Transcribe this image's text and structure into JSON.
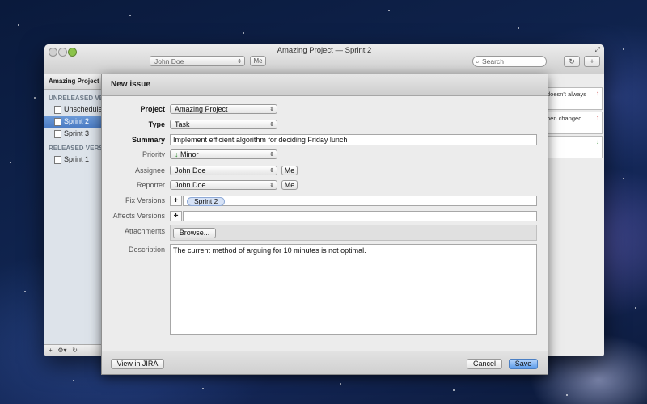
{
  "window": {
    "title": "Amazing Project — Sprint 2",
    "user_select": "John Doe",
    "me_button": "Me",
    "search_placeholder": "Search",
    "refresh_icon": "↻",
    "add_icon": "+"
  },
  "sidebar": {
    "header": "Amazing Project",
    "unreleased_label": "UNRELEASED VERSIONS",
    "unreleased_items": [
      "Unscheduled",
      "Sprint 2",
      "Sprint 3"
    ],
    "released_label": "RELEASED VERSIONS",
    "released_items": [
      "Sprint 1"
    ],
    "footer_add": "+",
    "footer_gear": "⚙▾",
    "footer_refresh": "↻",
    "selected": "Sprint 2"
  },
  "right_cards": [
    {
      "text": "doesn't always",
      "arrow": "↑",
      "arrow_color": "#c62828"
    },
    {
      "text": "hen changed",
      "arrow": "↑",
      "arrow_color": "#c62828"
    },
    {
      "text": "",
      "arrow": "↓",
      "arrow_color": "#2e8b2e"
    }
  ],
  "dialog": {
    "title": "New issue",
    "labels": {
      "project": "Project",
      "type": "Type",
      "summary": "Summary",
      "priority": "Priority",
      "assignee": "Assignee",
      "reporter": "Reporter",
      "fix_versions": "Fix Versions",
      "affects_versions": "Affects Versions",
      "attachments": "Attachments",
      "description": "Description"
    },
    "values": {
      "project": "Amazing Project",
      "type": "Task",
      "summary": "Implement efficient algorithm for deciding Friday lunch",
      "priority_icon": "↓",
      "priority": "Minor",
      "assignee": "John Doe",
      "reporter": "John Doe",
      "fix_version_chip": "Sprint 2",
      "description": "The current method of arguing for 10 minutes is not optimal."
    },
    "buttons": {
      "me": "Me",
      "plus": "+",
      "browse": "Browse...",
      "view_in_jira": "View in JIRA",
      "cancel": "Cancel",
      "save": "Save"
    },
    "colors": {
      "save_accent": "#5b9bea",
      "priority_green": "#2e8b2e"
    }
  }
}
